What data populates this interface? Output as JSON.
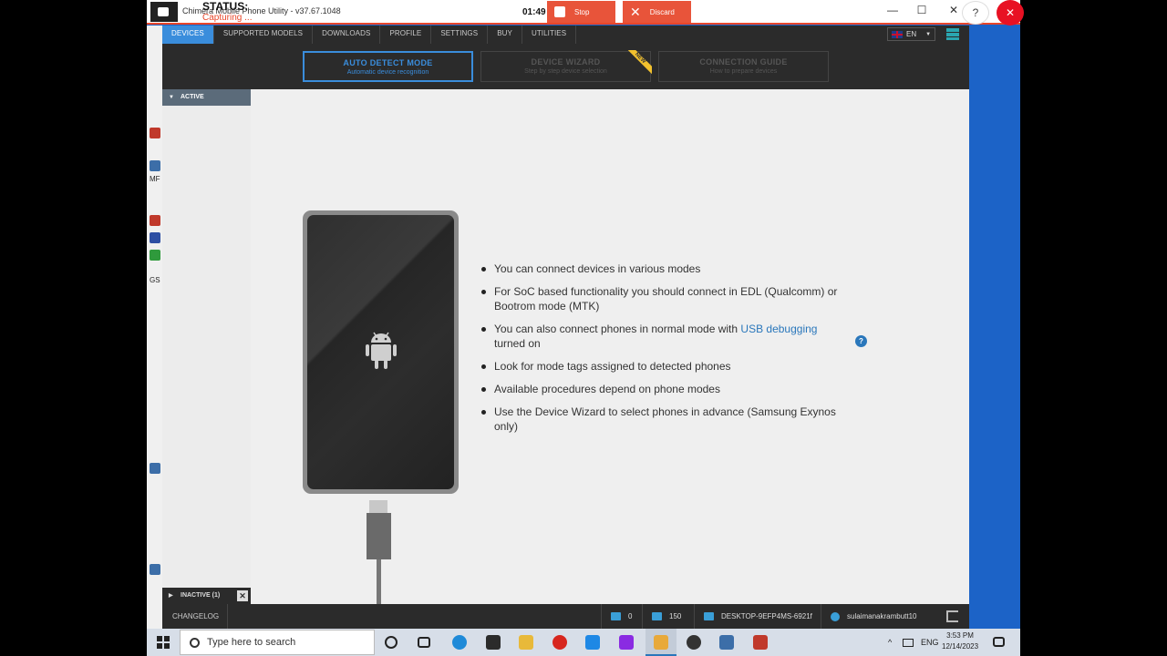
{
  "recorder": {
    "status_label": "STATUS:",
    "capturing_label": "Capturing ...",
    "timer": "01:49",
    "stop_label": "Stop",
    "discard_label": "Discard"
  },
  "window": {
    "title": "Chimera Mobile Phone Utility - v37.67.1048",
    "minimize": "—",
    "maximize": "☐",
    "close": "✕",
    "help": "?",
    "close_circle": "✕"
  },
  "nav": {
    "items": [
      "DEVICES",
      "SUPPORTED MODELS",
      "DOWNLOADS",
      "PROFILE",
      "SETTINGS",
      "BUY",
      "UTILITIES"
    ],
    "language": "EN"
  },
  "modes": [
    {
      "title": "AUTO DETECT MODE",
      "subtitle": "Automatic device recognition"
    },
    {
      "title": "DEVICE WIZARD",
      "subtitle": "Step by step device selection",
      "badge": "NEW"
    },
    {
      "title": "CONNECTION GUIDE",
      "subtitle": "How to prepare devices"
    }
  ],
  "sidebar": {
    "active_label": "ACTIVE",
    "inactive_label": "INACTIVE (1)"
  },
  "guide": {
    "bullets": [
      {
        "text": "You can connect devices in various modes"
      },
      {
        "text": "For SoC based functionality you should connect in EDL (Qualcomm) or Bootrom mode (MTK)"
      },
      {
        "before": "You can also connect phones in normal mode with ",
        "link": "USB debugging",
        "after": " turned on"
      },
      {
        "text": "Look for mode tags assigned to detected phones"
      },
      {
        "text": "Available procedures depend on phone modes"
      },
      {
        "text": "Use the Device Wizard to select phones in advance (Samsung Exynos only)"
      }
    ],
    "help_mark": "?"
  },
  "footer": {
    "changelog": "CHANGELOG",
    "messages": "0",
    "credits": "150",
    "computer": "DESKTOP-9EFP4MS-6921f",
    "user": "sulaimanakrambutt10"
  },
  "taskbar": {
    "search_placeholder": "Type here to search",
    "lang": "ENG",
    "time": "3:53 PM",
    "date": "12/14/2023"
  },
  "desktop": {
    "labels": [
      "MF",
      "GS"
    ]
  },
  "colors": {
    "accent": "#3a8ddc",
    "recorder_red": "#e8543a",
    "link": "#2a77bb",
    "badge": "#f2c12e"
  }
}
